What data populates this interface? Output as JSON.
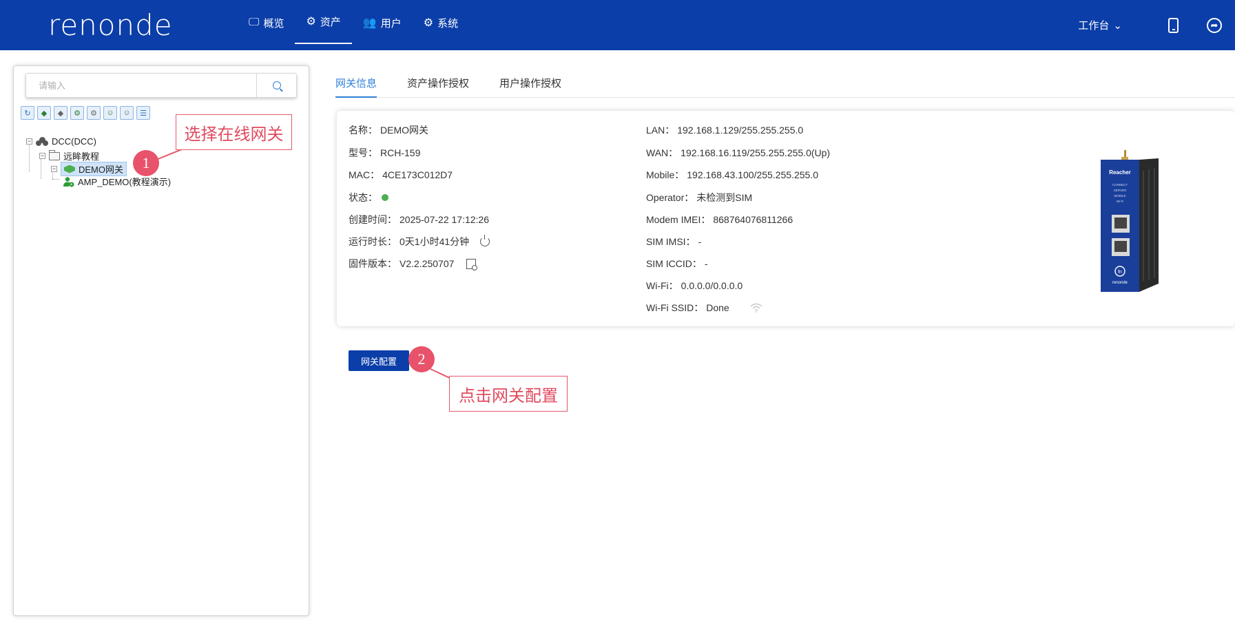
{
  "header": {
    "logo_text": "renonde",
    "nav": [
      {
        "label": "概览",
        "icon": "monitor-icon",
        "active": false
      },
      {
        "label": "资产",
        "icon": "cogs-icon",
        "active": true
      },
      {
        "label": "用户",
        "icon": "users-icon",
        "active": false
      },
      {
        "label": "系统",
        "icon": "gear-icon",
        "active": false
      }
    ],
    "workbench_label": "工作台",
    "workbench_arrow": "⌄"
  },
  "sidebar": {
    "search_placeholder": "请输入",
    "toolbar_icons": [
      "refresh-icon",
      "online-gateway-icon",
      "offline-gateway-icon",
      "gateway-config-icon",
      "gateway-settings-icon",
      "users-group-icon",
      "users-icon",
      "list-icon"
    ],
    "tree": {
      "root": "DCC(DCC)",
      "folder": "远眸教程",
      "gateway": "DEMO网关",
      "device": "AMP_DEMO(教程演示)"
    }
  },
  "annotations": {
    "step1_number": "1",
    "step1_text": "选择在线网关",
    "step2_number": "2",
    "step2_text": "点击网关配置"
  },
  "tabs": [
    {
      "label": "网关信息",
      "active": true
    },
    {
      "label": "资产操作授权",
      "active": false
    },
    {
      "label": "用户操作授权",
      "active": false
    }
  ],
  "gateway_info": {
    "left": [
      {
        "label": "名称：",
        "value": "DEMO网关"
      },
      {
        "label": "型号：",
        "value": "RCH-159"
      },
      {
        "label": "MAC：",
        "value": "4CE173C012D7"
      },
      {
        "label": "状态：",
        "value": ""
      },
      {
        "label": "创建时间：",
        "value": "2025-07-22 17:12:26"
      },
      {
        "label": "运行时长：",
        "value": "0天1小时41分钟"
      },
      {
        "label": "固件版本：",
        "value": "V2.2.250707"
      }
    ],
    "right": [
      {
        "label": "LAN：",
        "value": "192.168.1.129/255.255.255.0"
      },
      {
        "label": "WAN：",
        "value": "192.168.16.119/255.255.255.0(Up)"
      },
      {
        "label": "Mobile：",
        "value": "192.168.43.100/255.255.255.0"
      },
      {
        "label": "Operator：",
        "value": "未检测到SIM"
      },
      {
        "label": "Modem IMEI：",
        "value": "868764076811266"
      },
      {
        "label": "SIM IMSI：",
        "value": "-"
      },
      {
        "label": "SIM ICCID：",
        "value": "-"
      },
      {
        "label": "Wi-Fi：",
        "value": "0.0.0.0/0.0.0.0"
      },
      {
        "label": "Wi-Fi SSID：",
        "value": "Done"
      }
    ],
    "status_color": "#4caf50",
    "device_image": {
      "brand": "Reacher",
      "labels": [
        "CONNECT",
        "SERVER",
        "MOBILE",
        "Wi-Fi"
      ],
      "bottom_brand": "renonde"
    }
  },
  "actions": {
    "config_button_label": "网关配置"
  },
  "colors": {
    "header_bg": "#0b3ea8",
    "accent": "#2f7fd8",
    "callout": "#e9526b"
  }
}
